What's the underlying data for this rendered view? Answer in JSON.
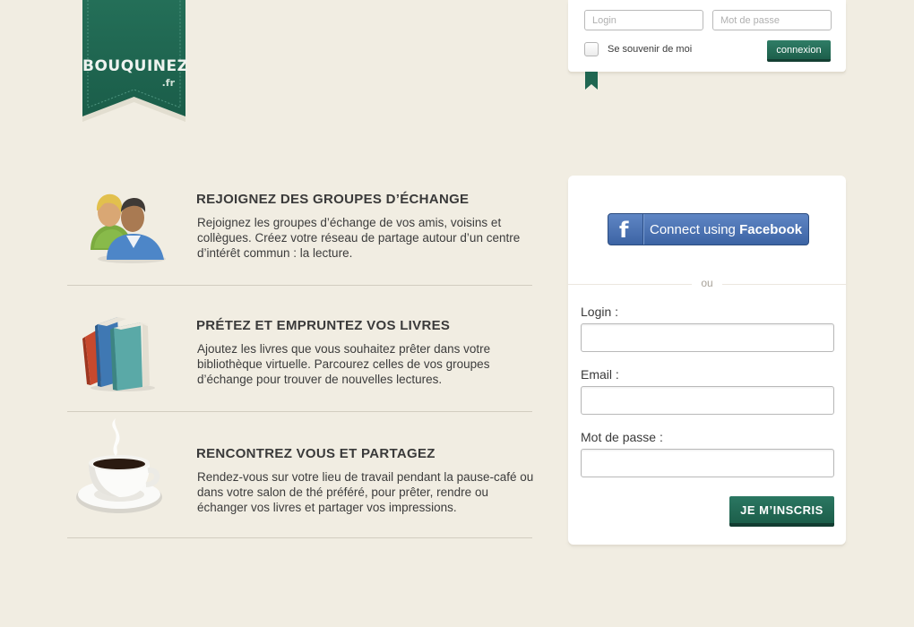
{
  "brand": {
    "name": "BOUQUINEZ",
    "tld": ".fr",
    "color": "#1f6651"
  },
  "top_login": {
    "login_placeholder": "Login",
    "password_placeholder": "Mot de passe",
    "remember_label": "Se souvenir de moi",
    "submit_label": "connexion"
  },
  "features": [
    {
      "icon": "users-icon",
      "title": "REJOIGNEZ DES GROUPES D’ÉCHANGE",
      "text": "Rejoignez les groupes d’échange de vos amis, voisins et collègues. Créez votre réseau de partage autour d’un centre d’intérêt commun : la lecture."
    },
    {
      "icon": "books-icon",
      "title": "PRÉTEZ ET EMPRUNTEZ VOS LIVRES",
      "text": "Ajoutez les livres que vous souhaitez prêter dans votre bibliothèque virtuelle. Parcourez celles de vos groupes d’échange pour trouver de nouvelles lectures."
    },
    {
      "icon": "coffee-cup-icon",
      "title": "RENCONTREZ VOUS ET PARTAGEZ",
      "text": "Rendez-vous sur votre lieu de travail pendant la pause-café ou dans votre salon de thé préféré, pour prêter, rendre ou échanger vos livres et partager vos impressions."
    }
  ],
  "signup": {
    "facebook_prefix": "Connect using ",
    "facebook_brand": "Facebook",
    "or_text": "ou",
    "login_label": "Login :",
    "email_label": "Email :",
    "password_label": "Mot de passe :",
    "submit_label": "JE M’INSCRIS"
  }
}
